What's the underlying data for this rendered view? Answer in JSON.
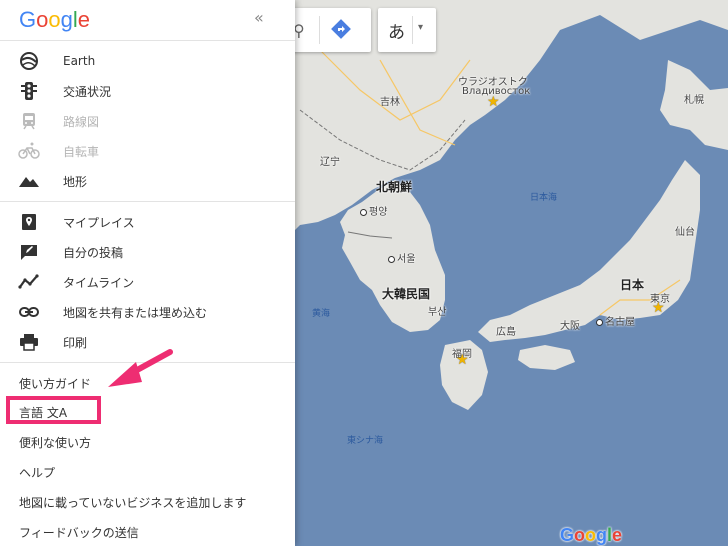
{
  "app": {
    "logo_letters": [
      "G",
      "o",
      "o",
      "g",
      "l",
      "e"
    ],
    "logo_colors": [
      "#4285f4",
      "#ea4335",
      "#fbbc05",
      "#4285f4",
      "#34a853",
      "#ea4335"
    ]
  },
  "sidebar": {
    "collapse_label": "«",
    "layers": [
      {
        "label": "Earth",
        "icon": "earth-icon",
        "enabled": true
      },
      {
        "label": "交通状況",
        "icon": "traffic-light-icon",
        "enabled": true
      },
      {
        "label": "路線図",
        "icon": "train-icon",
        "enabled": false
      },
      {
        "label": "自転車",
        "icon": "bicycle-icon",
        "enabled": false
      },
      {
        "label": "地形",
        "icon": "terrain-icon",
        "enabled": true
      }
    ],
    "personal": [
      {
        "label": "マイプレイス",
        "icon": "place-pin-icon"
      },
      {
        "label": "自分の投稿",
        "icon": "edit-post-icon"
      },
      {
        "label": "タイムライン",
        "icon": "timeline-icon"
      },
      {
        "label": "地図を共有または埋め込む",
        "icon": "link-icon"
      },
      {
        "label": "印刷",
        "icon": "print-icon"
      }
    ],
    "text_links": [
      "使い方ガイド",
      "言語 文A",
      "便利な使い方",
      "ヘルプ",
      "地図に載っていないビジネスを追加します",
      "フィードバックの送信"
    ]
  },
  "controls": {
    "language_button": "あ",
    "caret": "▾"
  },
  "map": {
    "cities": {
      "vladivostok_ja": "ウラジオストク",
      "vladivostok_ru": "Владивосток",
      "sapporo": "札幌",
      "jilin": "吉林",
      "liaoning": "辽宁",
      "north_korea": "北朝鮮",
      "pyongyang": "평양",
      "seoul": "서울",
      "south_korea": "大韓民国",
      "busan": "부산",
      "japan": "日本",
      "sendai": "仙台",
      "tokyo": "東京",
      "nagoya": "名古屋",
      "osaka": "大阪",
      "hiroshima": "広島",
      "fukuoka": "福岡"
    },
    "seas": {
      "sea_of_japan": "日本海",
      "yellow_sea": "黄海",
      "east_china_sea": "東シナ海"
    },
    "watermark_letters": [
      "G",
      "o",
      "o",
      "g",
      "l",
      "e"
    ],
    "colors": {
      "water": "#6b8bb5",
      "land": "#e3e3df",
      "highlight": "#ee2d72"
    }
  }
}
